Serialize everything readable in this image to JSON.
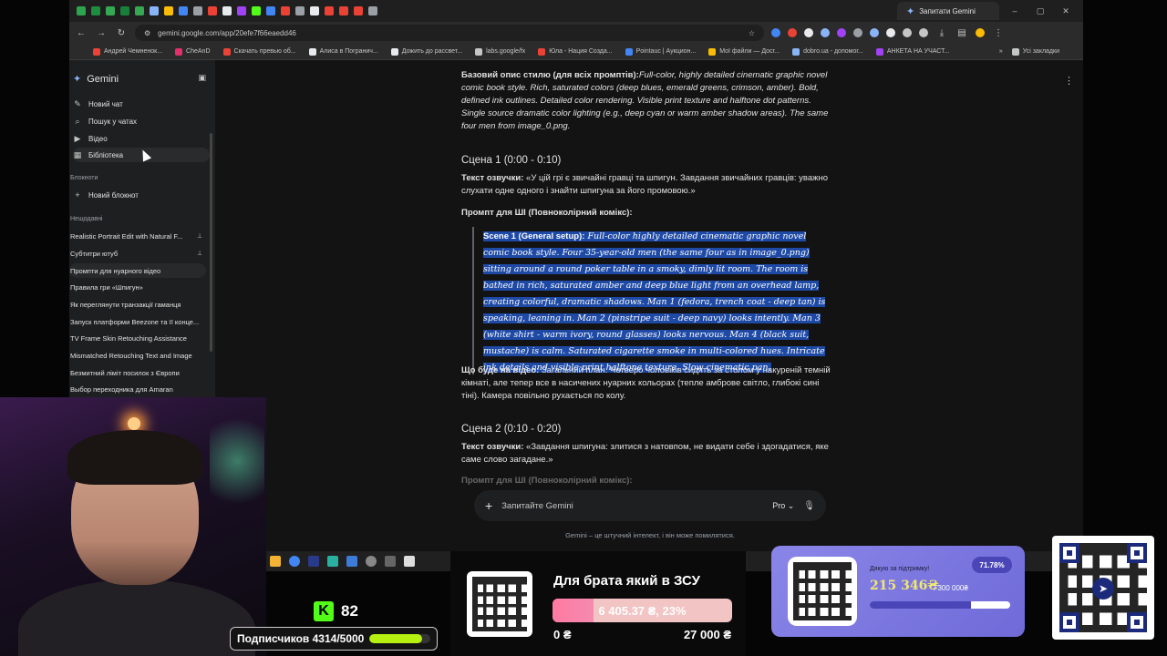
{
  "browser": {
    "tab_title": "Запитати Gemini",
    "url": "gemini.google.com/app/20efe7f66eaedd46",
    "bookmarks": [
      "Андрей Чемненок...",
      "CheAnD",
      "Скачать превью об...",
      "Алиса в Погранич...",
      "Дожить до рассвет...",
      "labs.google/fx",
      "Юла - Нация Созда...",
      "Pointauc | Аукцион...",
      "Мої файли — Досг...",
      "dobro.ua - допомог...",
      "АНКЕТА НА УЧАСТ..."
    ],
    "bookmarks_folder": "Усі закладки"
  },
  "sidebar": {
    "app_name": "Gemini",
    "items": [
      {
        "label": "Новий чат",
        "icon": "edit-icon"
      },
      {
        "label": "Пошук у чатах",
        "icon": "search-icon"
      },
      {
        "label": "Відео",
        "icon": "video-icon"
      },
      {
        "label": "Бібліотека",
        "icon": "library-icon"
      }
    ],
    "notebooks_title": "Блокноти",
    "new_notebook": "Новий блокнот",
    "recent_title": "Нещодавні",
    "recent": [
      {
        "label": "Realistic Portrait Edit with Natural F...",
        "pinned": true
      },
      {
        "label": "Субтитри ютуб",
        "pinned": true
      },
      {
        "label": "Промпти для нуарного відео",
        "pinned": false
      },
      {
        "label": "Правила гри «Шпигун»",
        "pinned": false
      },
      {
        "label": "Як переглянути транзакції гаманця",
        "pinned": false
      },
      {
        "label": "Запуск платформи Beezone та її конце...",
        "pinned": false
      },
      {
        "label": "TV Frame Skin Retouching Assistance",
        "pinned": false
      },
      {
        "label": "Mismatched Retouching Text and Image",
        "pinned": false
      },
      {
        "label": "Безмитний ліміт посилок з Європи",
        "pinned": false
      },
      {
        "label": "Выбор переходника для Amaran",
        "pinned": false
      }
    ]
  },
  "chat": {
    "base_style_label": "Базовий опис стилю (для всіх промптів):",
    "base_style_text": "Full-color, highly detailed cinematic graphic novel comic book style. Rich, saturated colors (deep blues, emerald greens, crimson, amber). Bold, defined ink outlines. Detailed color rendering. Visible print texture and halftone dot patterns. Single source dramatic color lighting (e.g., deep cyan or warm amber shadow areas). The same four men from image_0.png.",
    "scene1_title": "Сцена 1 (0:00 - 0:10)",
    "voiceover_label": "Текст озвучки:",
    "scene1_voiceover": "«У цій грі є звичайні гравці та шпигун. Завдання звичайних гравців: уважно слухати одне одного і знайти шпигуна за його промовою.»",
    "prompt_label": "Промпт для ШІ (Повноколірний комікс):",
    "scene1_prompt_label": "Scene 1 (General setup):",
    "scene1_prompt_text": "Full-color highly detailed cinematic graphic novel comic book style. Four 35-year-old men (the same four as in image_0.png) sitting around a round poker table in a smoky, dimly lit room. The room is bathed in rich, saturated amber and deep blue light from an overhead lamp, creating colorful, dramatic shadows. Man 1 (fedora, trench coat - deep tan) is speaking, leaning in. Man 2 (pinstripe suit - deep navy) looks intently. Man 3 (white shirt - warm ivory, round glasses) looks nervous. Man 4 (black suit, mustache) is calm. Saturated cigarette smoke in multi-colored hues. Intricate ink details and visible print halftone texture. Slow cinematic pan.",
    "video_label": "Що буде на відео:",
    "scene1_video": "Загальний план. Четверо чоловіків сидять за столом у накуреній темній кімнаті, але тепер все в насичених нуарних кольорах (тепле амброве світло, глибокі сині тіні). Камера повільно рухається по колу.",
    "scene2_title": "Сцена 2 (0:10 - 0:20)",
    "scene2_voiceover": "«Завдання шпигуна: злитися з натовпом, не видати себе і здогадатися, яке саме слово загадане.»",
    "scene2_prompt_label": "Промпт для ШІ (Повноколірний комікс):"
  },
  "input": {
    "placeholder": "Запитайте Gemini",
    "model": "Pro",
    "disclaimer": "Gemini – це штучний інтелект, і він може помилятися."
  },
  "stream": {
    "kick_count": "82",
    "subs_label": "Подписчиков 4314/5000",
    "subs_progress": 0.8628,
    "donation_title": "Для брата який в ЗСУ",
    "donation_bar_text": "6 405.37 ₴, 23%",
    "donation_progress": 0.23,
    "donation_min": "0 ₴",
    "donation_max": "27 000 ₴",
    "support_label": "Дякую за підтримку!",
    "support_percent": "71.78%",
    "support_amount": "215 346₴",
    "support_goal": "/ 300 000₴",
    "support_progress": 0.7178
  },
  "colors": {
    "selection": "#1e4aa6",
    "subs_bar": "#b5f011",
    "support_card": "#8a86e8",
    "kick_green": "#53fc18"
  }
}
